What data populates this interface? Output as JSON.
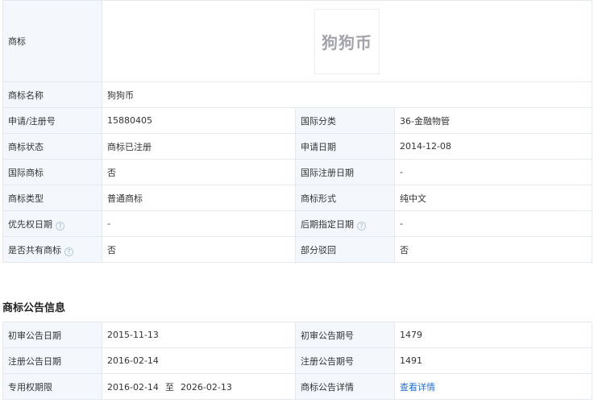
{
  "trademark_info": {
    "logo_label": "商标",
    "logo_text": "狗狗币",
    "name_label": "商标名称",
    "name_value": "狗狗币",
    "rows": [
      {
        "l1": "申请/注册号",
        "v1": "15880405",
        "l2": "国际分类",
        "v2": "36-金融物管"
      },
      {
        "l1": "商标状态",
        "v1": "商标已注册",
        "l2": "申请日期",
        "v2": "2014-12-08"
      },
      {
        "l1": "国际商标",
        "v1": "否",
        "l2": "国际注册日期",
        "v2": "-"
      },
      {
        "l1": "商标类型",
        "v1": "普通商标",
        "l2": "商标形式",
        "v2": "纯中文"
      },
      {
        "l1": "优先权日期",
        "v1": "-",
        "l2": "后期指定日期",
        "v2": "-"
      },
      {
        "l1": "是否共有商标",
        "v1": "否",
        "l2": "部分驳回",
        "v2": "否"
      }
    ]
  },
  "announcement": {
    "title": "商标公告信息",
    "rows": [
      {
        "l1": "初审公告日期",
        "v1": "2015-11-13",
        "l2": "初审公告期号",
        "v2": "1479"
      },
      {
        "l1": "注册公告日期",
        "v1": "2016-02-14",
        "l2": "注册公告期号",
        "v2": "1491"
      }
    ],
    "validity_label": "专用权期限",
    "validity_start": "2016-02-14",
    "validity_sep": "至",
    "validity_end": "2026-02-13",
    "detail_label": "商标公告详情",
    "detail_link": "查看详情"
  },
  "icons": {
    "help": "question-circle-icon",
    "help_glyph": "?"
  }
}
